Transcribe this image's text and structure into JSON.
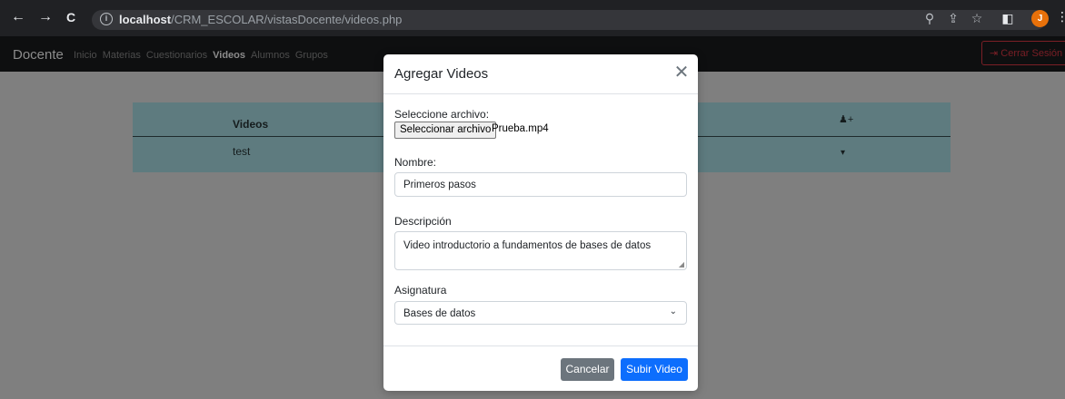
{
  "browser": {
    "back_icon": "←",
    "forward_icon": "→",
    "reload_icon": "C",
    "info_icon": "i",
    "url_host": "localhost",
    "url_path": "/CRM_ESCOLAR/vistasDocente/videos.php",
    "zoom_icon": "⚲",
    "share_icon": "⇪",
    "star_icon": "☆",
    "sidepanel_icon": "◧",
    "avatar_letter": "J",
    "menu_icon": "⋮"
  },
  "navbar": {
    "brand": "Docente",
    "links": [
      "Inicio",
      "Materias",
      "Cuestionarios",
      "Videos",
      "Alumnos",
      "Grupos"
    ],
    "active": "Videos",
    "logout_label": "Cerrar Sesión",
    "logout_icon": "⇥"
  },
  "table": {
    "header_videos": "Videos",
    "add_icon": "♟+",
    "rows": [
      {
        "name": "test",
        "action_icon": "▾"
      }
    ]
  },
  "modal": {
    "title": "Agregar Videos",
    "close_icon": "✕",
    "file_label": "Seleccione archivo:",
    "file_button": "Seleccionar archivo",
    "file_name": "Prueba.mp4",
    "name_label": "Nombre:",
    "name_value": "Primeros pasos",
    "desc_label": "Descripción",
    "desc_value": "Video introductorio a fundamentos de bases de datos",
    "subject_label": "Asignatura",
    "subject_value": "Bases de datos",
    "cancel_label": "Cancelar",
    "submit_label": "Subir Video"
  },
  "colors": {
    "primary": "#0d6efd",
    "secondary": "#6c757d",
    "backdrop": "#7f7f7f"
  }
}
